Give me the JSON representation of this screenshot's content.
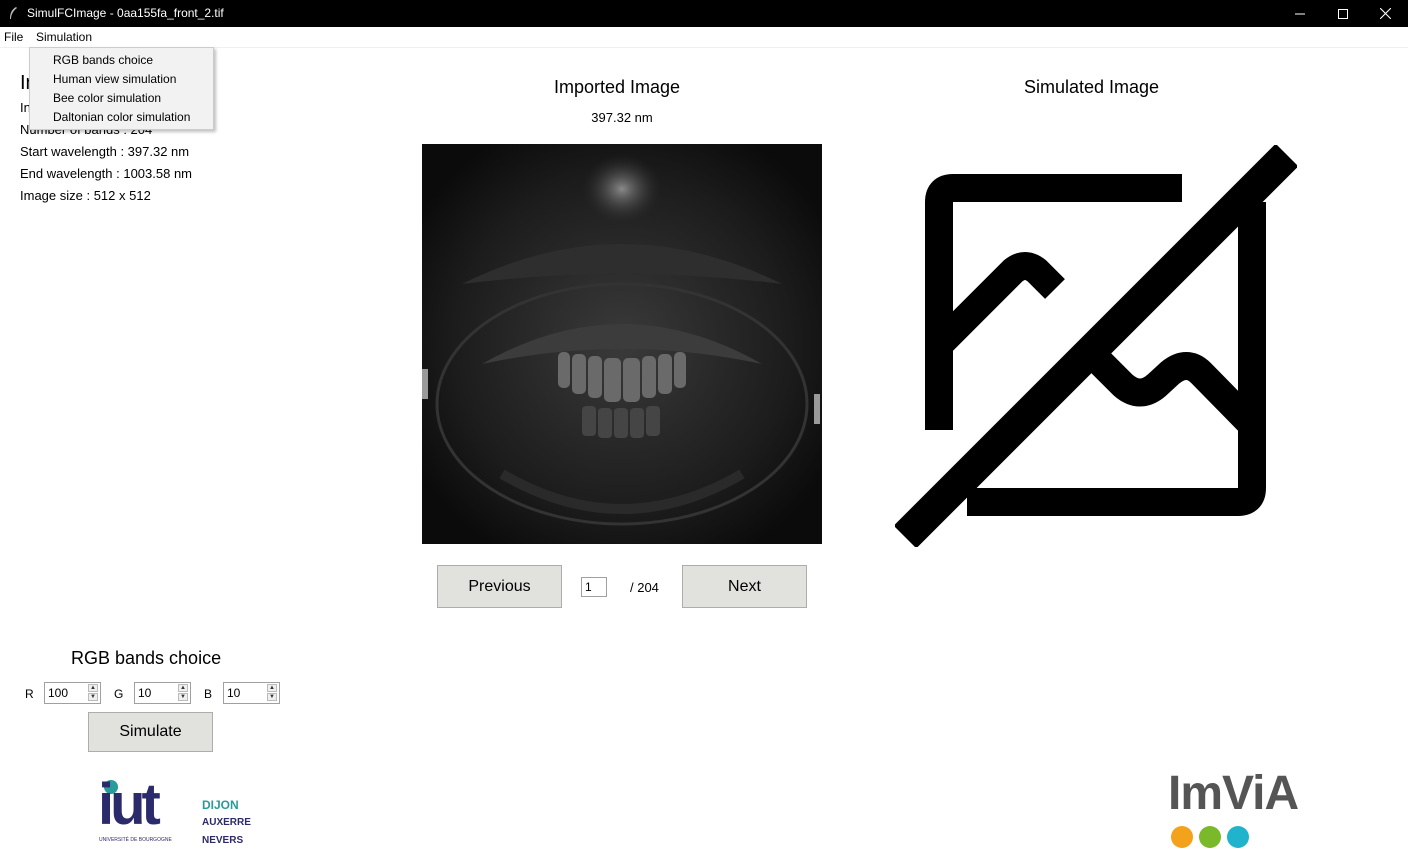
{
  "window": {
    "title": "SimulFCImage - 0aa155fa_front_2.tif",
    "controls": {
      "minimize": "—",
      "maximize": "☐",
      "close": "✕"
    }
  },
  "menubar": {
    "file": "File",
    "simulation": "Simulation"
  },
  "simulation_menu": {
    "items": [
      "RGB bands choice",
      "Human view simulation",
      "Bee color simulation",
      "Daltonian color simulation"
    ]
  },
  "info": {
    "title_visible": "In",
    "line1_visible": "In",
    "line1_tail_visible": "f",
    "bands_visible": "Number of bands : 204",
    "start_wavelength": "Start wavelength : 397.32 nm",
    "end_wavelength": "End wavelength : 1003.58 nm",
    "image_size": "Image size : 512 x 512"
  },
  "imported": {
    "title": "Imported Image",
    "wavelength": "397.32 nm"
  },
  "simulated": {
    "title": "Simulated Image",
    "placeholder_icon": "image-off-icon"
  },
  "navigation": {
    "previous_label": "Previous",
    "next_label": "Next",
    "page_value": "1",
    "page_total": "/ 204"
  },
  "rgb_panel": {
    "title": "RGB bands choice",
    "r_label": "R",
    "r_value": "100",
    "g_label": "G",
    "g_value": "10",
    "b_label": "B",
    "b_value": "10",
    "simulate_label": "Simulate"
  },
  "logos": {
    "iut": {
      "main": "iut",
      "line1": "DIJON",
      "line2": "AUXERRE",
      "line3": "NEVERS",
      "tagline": "UNIVERSITÉ DE BOURGOGNE"
    },
    "imvia": {
      "text": "ImViA",
      "dot_colors": [
        "#f4a11c",
        "#7ab929",
        "#1fb4cc"
      ]
    }
  },
  "colors": {
    "titlebar": "#000000",
    "button": "#e1e1de",
    "iut_navy": "#2b2a6b",
    "iut_teal": "#2a9a9a",
    "imvia_gray": "#555555"
  }
}
